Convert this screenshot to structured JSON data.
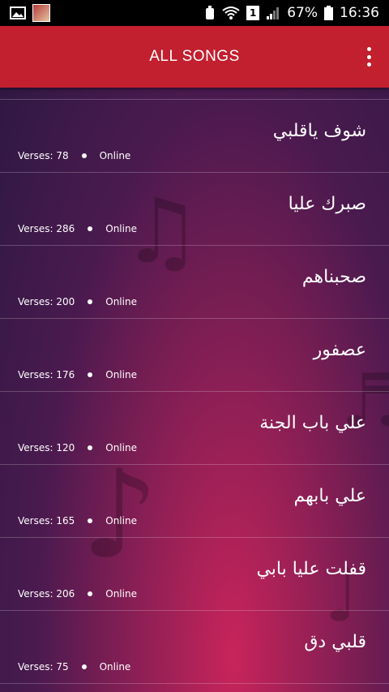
{
  "status_bar": {
    "battery": "67%",
    "time": "16:36",
    "sim_badge": "1"
  },
  "app_bar": {
    "title": "ALL SONGS"
  },
  "songs": [
    {
      "title": "شوف ياقلبي",
      "verses": "Verses: 78",
      "status": "Online"
    },
    {
      "title": "صبرك عليا",
      "verses": "Verses: 286",
      "status": "Online"
    },
    {
      "title": "صحبناهم",
      "verses": "Verses: 200",
      "status": "Online"
    },
    {
      "title": "عصفور",
      "verses": "Verses: 176",
      "status": "Online"
    },
    {
      "title": "علي باب الجنة",
      "verses": "Verses: 120",
      "status": "Online"
    },
    {
      "title": "علي بابهم",
      "verses": "Verses: 165",
      "status": "Online"
    },
    {
      "title": "قفلت عليا بابي",
      "verses": "Verses: 206",
      "status": "Online"
    },
    {
      "title": "قلبي دق",
      "verses": "Verses: 75",
      "status": "Online"
    }
  ],
  "colors": {
    "app_bar": "#c21f2f",
    "status_bar": "#000000"
  }
}
